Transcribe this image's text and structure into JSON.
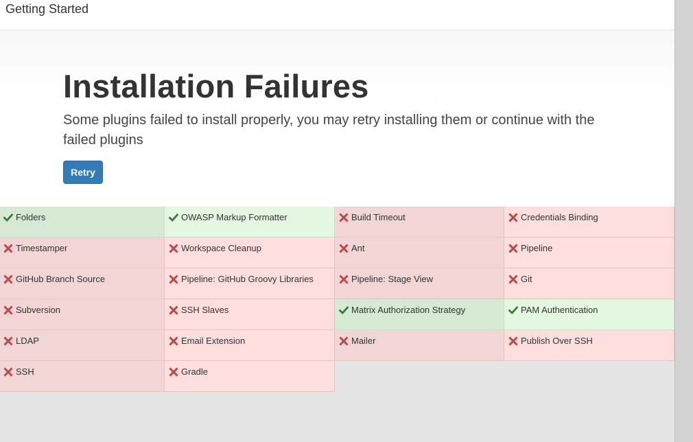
{
  "header": {
    "title": "Getting Started"
  },
  "hero": {
    "title": "Installation Failures",
    "description": "Some plugins failed to install properly, you may retry installing them or continue with the failed plugins",
    "retry_label": "Retry"
  },
  "colors": {
    "fail_bg": "#ffdede",
    "ok_bg": "#e4f8e1",
    "fail_icon": "#b94a48",
    "ok_icon": "#3c763d",
    "button": "#337ab7"
  },
  "plugins": {
    "columns": [
      [
        {
          "name": "Folders",
          "status": "ok"
        },
        {
          "name": "Timestamper",
          "status": "failed"
        },
        {
          "name": "GitHub Branch Source",
          "status": "failed"
        },
        {
          "name": "Subversion",
          "status": "failed"
        },
        {
          "name": "LDAP",
          "status": "failed"
        },
        {
          "name": "SSH",
          "status": "failed"
        }
      ],
      [
        {
          "name": "OWASP Markup Formatter",
          "status": "ok"
        },
        {
          "name": "Workspace Cleanup",
          "status": "failed"
        },
        {
          "name": "Pipeline: GitHub Groovy Libraries",
          "status": "failed"
        },
        {
          "name": "SSH Slaves",
          "status": "failed"
        },
        {
          "name": "Email Extension",
          "status": "failed"
        },
        {
          "name": "Gradle",
          "status": "failed"
        }
      ],
      [
        {
          "name": "Build Timeout",
          "status": "failed"
        },
        {
          "name": "Ant",
          "status": "failed"
        },
        {
          "name": "Pipeline: Stage View",
          "status": "failed"
        },
        {
          "name": "Matrix Authorization Strategy",
          "status": "ok"
        },
        {
          "name": "Mailer",
          "status": "failed"
        }
      ],
      [
        {
          "name": "Credentials Binding",
          "status": "failed"
        },
        {
          "name": "Pipeline",
          "status": "failed"
        },
        {
          "name": "Git",
          "status": "failed"
        },
        {
          "name": "PAM Authentication",
          "status": "ok"
        },
        {
          "name": "Publish Over SSH",
          "status": "failed"
        }
      ]
    ],
    "icons": {
      "ok": "check-icon",
      "failed": "x-icon"
    }
  }
}
